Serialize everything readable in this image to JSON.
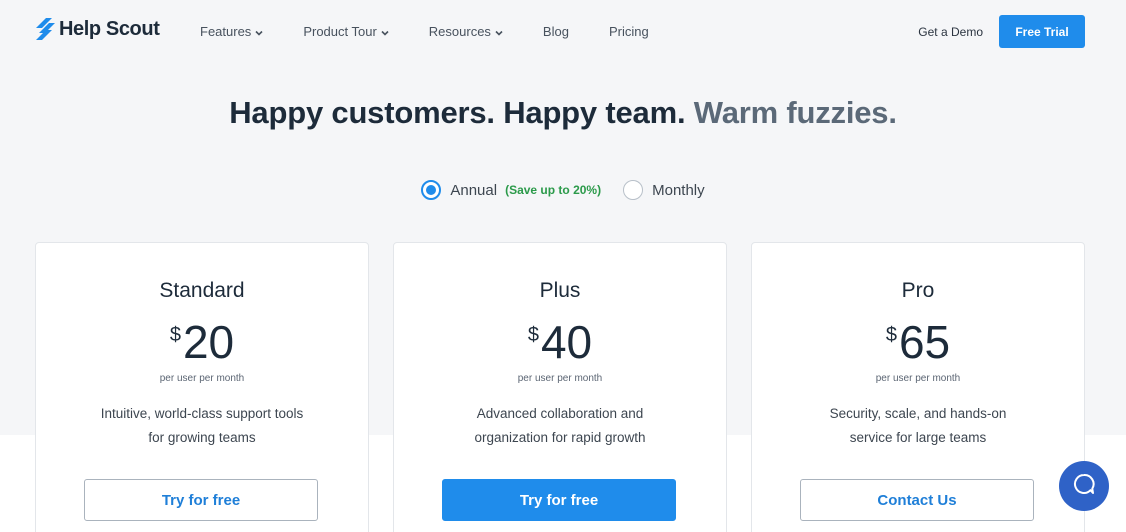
{
  "nav": {
    "logo_text": "Help Scout",
    "links": [
      {
        "label": "Features",
        "has_menu": true
      },
      {
        "label": "Product Tour",
        "has_menu": true
      },
      {
        "label": "Resources",
        "has_menu": true
      },
      {
        "label": "Blog",
        "has_menu": false
      },
      {
        "label": "Pricing",
        "has_menu": false
      }
    ],
    "demo_label": "Get a Demo",
    "trial_label": "Free Trial"
  },
  "hero": {
    "headline_main": "Happy customers. Happy team.",
    "headline_soft": "Warm fuzzies."
  },
  "billing": {
    "annual_label": "Annual",
    "annual_note": "(Save up to 20%)",
    "monthly_label": "Monthly",
    "selected": "annual"
  },
  "plans": [
    {
      "name": "Standard",
      "currency": "$",
      "price": "20",
      "per": "per user per month",
      "desc_line1": "Intuitive, world-class support tools",
      "desc_line2": "for growing teams",
      "cta": "Try for free"
    },
    {
      "name": "Plus",
      "currency": "$",
      "price": "40",
      "per": "per user per month",
      "desc_line1": "Advanced collaboration and",
      "desc_line2": "organization for rapid growth",
      "cta": "Try for free"
    },
    {
      "name": "Pro",
      "currency": "$",
      "price": "65",
      "per": "per user per month",
      "desc_line1": "Security, scale, and hands-on",
      "desc_line2": "service for large teams",
      "cta": "Contact Us"
    }
  ],
  "colors": {
    "accent": "#1f8ceb",
    "save_green": "#2b9a4a",
    "chat_bubble": "#2f62c7"
  },
  "icons": {
    "logo": "help-scout-logo-icon",
    "chat": "chat-bubble-icon",
    "dropdown": "chevron-down-icon"
  }
}
